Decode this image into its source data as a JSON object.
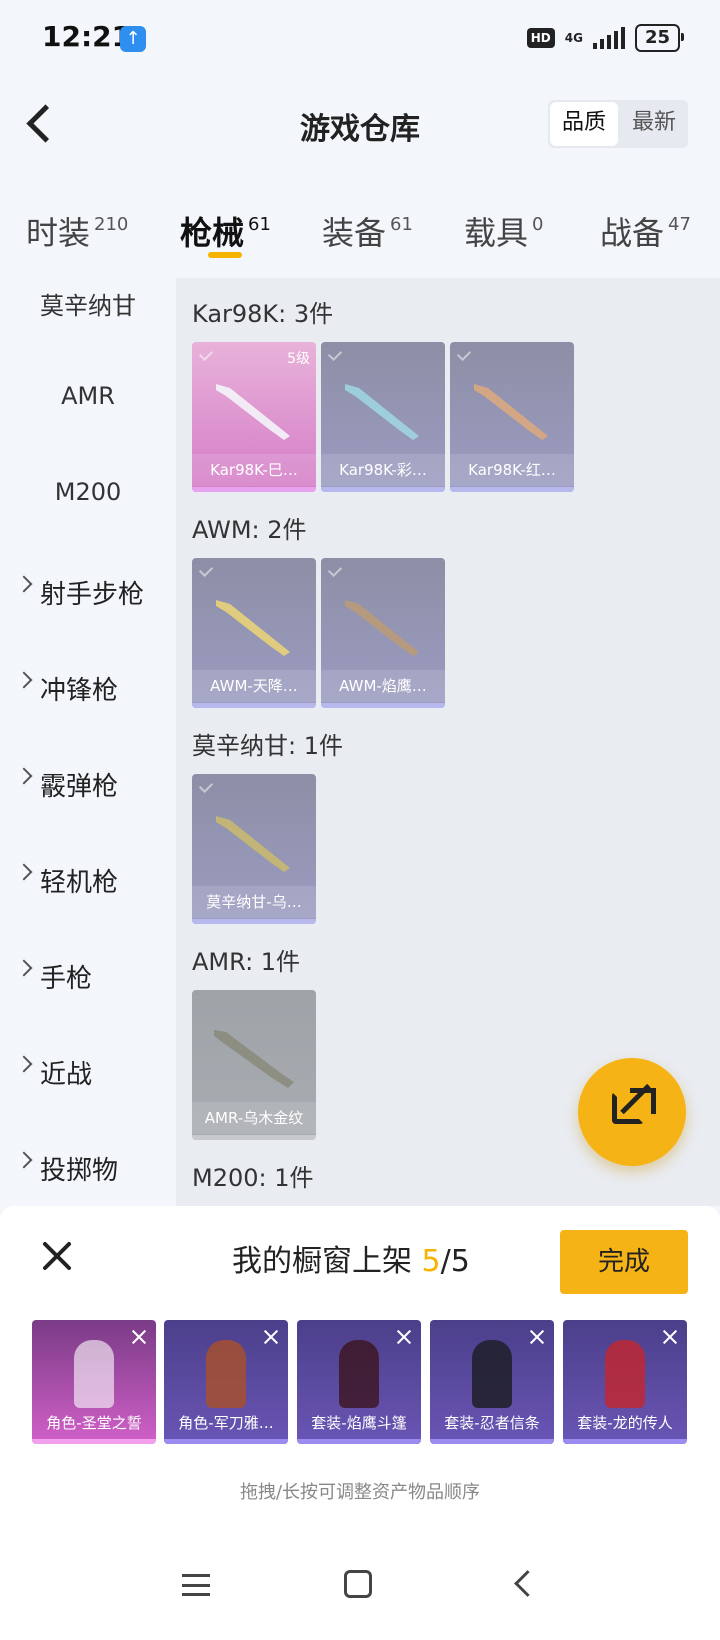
{
  "status": {
    "time": "12:21",
    "hd": "HD",
    "network": "4G",
    "battery": "25"
  },
  "header": {
    "title": "游戏仓库",
    "sort": [
      "品质",
      "最新"
    ]
  },
  "tabs": [
    {
      "label": "时装",
      "count": "210"
    },
    {
      "label": "枪械",
      "count": "61"
    },
    {
      "label": "装备",
      "count": "61"
    },
    {
      "label": "载具",
      "count": "0"
    },
    {
      "label": "战备",
      "count": "47"
    }
  ],
  "sidebar": {
    "items": [
      "莫辛纳甘",
      "AMR",
      "M200",
      "射手步枪",
      "冲锋枪",
      "霰弹枪",
      "轻机枪",
      "手枪",
      "近战",
      "投掷物"
    ]
  },
  "sections": [
    {
      "title": "Kar98K: 3件",
      "items": [
        {
          "name": "Kar98K-巳…",
          "level": "5级"
        },
        {
          "name": "Kar98K-彩…"
        },
        {
          "name": "Kar98K-红…"
        }
      ]
    },
    {
      "title": "AWM: 2件",
      "items": [
        {
          "name": "AWM-天降…"
        },
        {
          "name": "AWM-焰鹰…"
        }
      ]
    },
    {
      "title": "莫辛纳甘: 1件",
      "items": [
        {
          "name": "莫辛纳甘-乌…"
        }
      ]
    },
    {
      "title": "AMR: 1件",
      "items": [
        {
          "name": "AMR-乌木金纹"
        }
      ]
    },
    {
      "title": "M200: 1件",
      "items": []
    }
  ],
  "panel": {
    "title_prefix": "我的橱窗上架 ",
    "count": "5",
    "sep": "/",
    "total": "5",
    "done_label": "完成",
    "slots": [
      "角色-圣堂之誓",
      "角色-军刀雅…",
      "套装-焰鹰斗篷",
      "套装-忍者信条",
      "套装-龙的传人"
    ],
    "hint": "拖拽/长按可调整资产物品顺序"
  },
  "colors": {
    "accent": "#f6b316",
    "pink_card": "#d47cc7",
    "purple_card": "#9c9cc2"
  }
}
